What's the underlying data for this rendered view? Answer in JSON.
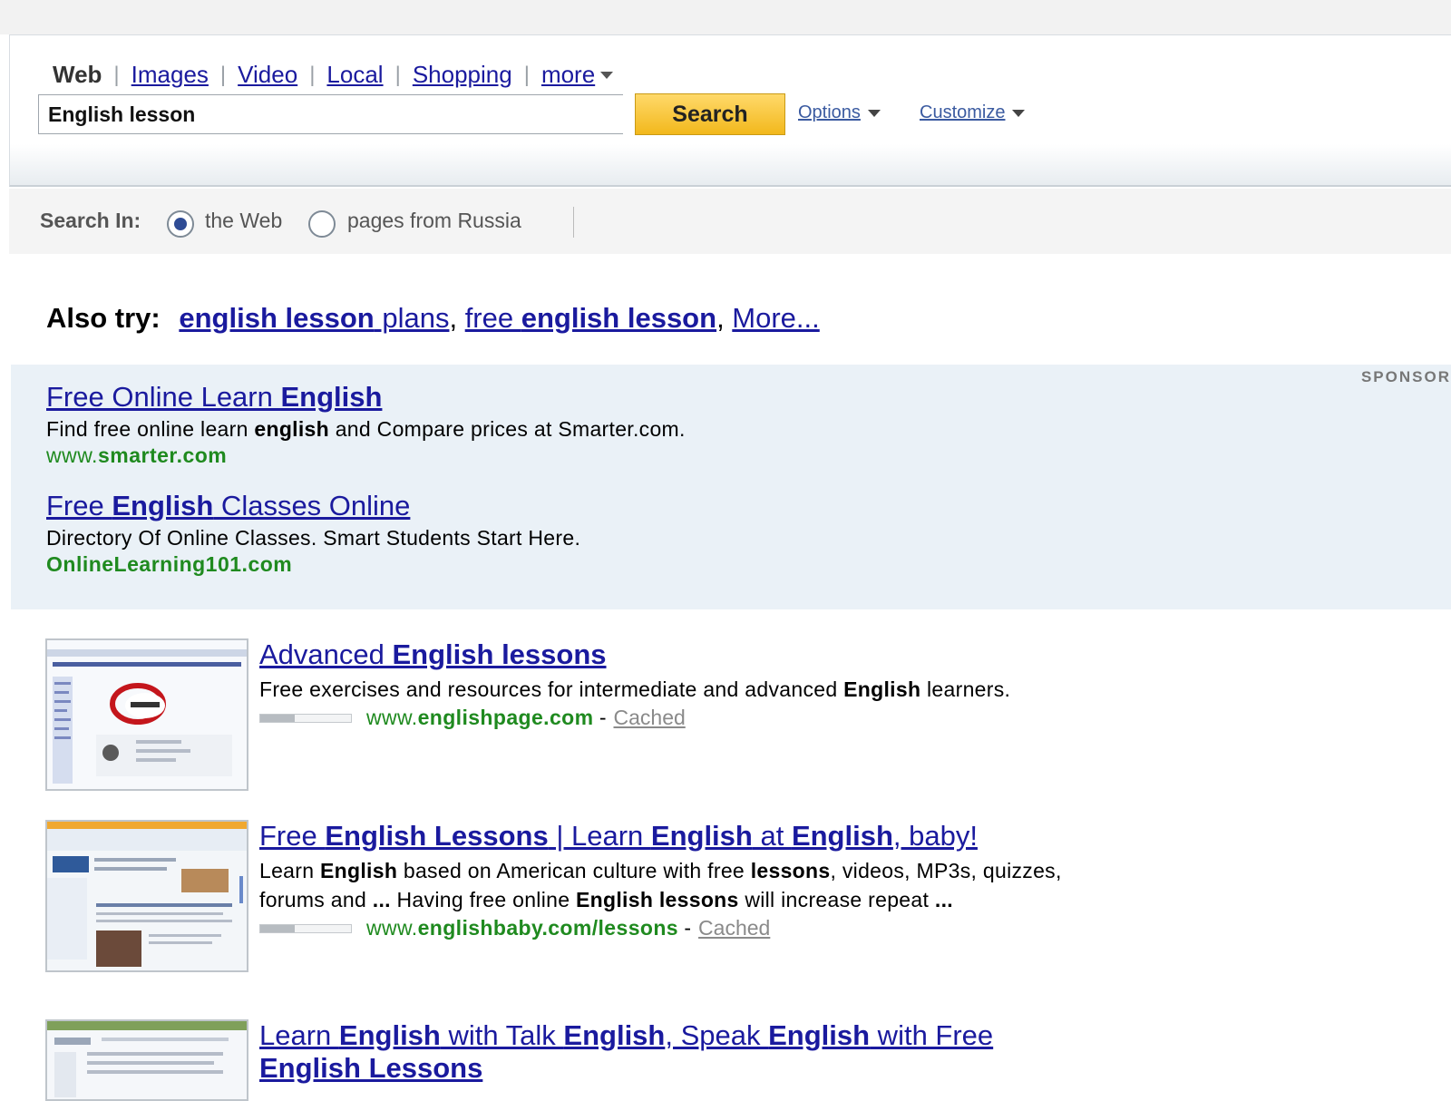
{
  "nav": {
    "tabs": [
      "Web",
      "Images",
      "Video",
      "Local",
      "Shopping"
    ],
    "more_label": "more"
  },
  "search": {
    "query": "English lesson",
    "button_label": "Search",
    "options_label": "Options",
    "customize_label": "Customize"
  },
  "search_in": {
    "label": "Search In:",
    "options": [
      "the Web",
      "pages from Russia"
    ],
    "selected": "the Web"
  },
  "also_try": {
    "label": "Also try:",
    "suggestions": [
      {
        "bold": "english lesson",
        "rest": " plans"
      },
      {
        "pre": "free ",
        "bold": "english lesson"
      }
    ],
    "more_label": "More..."
  },
  "sponsored": {
    "label": "SPONSOR",
    "ads": [
      {
        "title_pre": "Free Online Learn ",
        "title_bold": "English",
        "title_post": "",
        "desc_pre": "Find free online learn ",
        "desc_bold": "english",
        "desc_post": " and Compare prices at Smarter.com.",
        "url_pre": "www.",
        "url_bold": "smarter.com"
      },
      {
        "title_pre": "Free ",
        "title_bold": "English",
        "title_post": " Classes Online",
        "desc_pre": "Directory Of Online Classes. Smart Students Start Here.",
        "desc_bold": "",
        "desc_post": "",
        "url_pre": "",
        "url_bold": "OnlineLearning101.com"
      }
    ]
  },
  "results": [
    {
      "title": [
        {
          "t": "Advanced ",
          "b": false
        },
        {
          "t": "English lessons",
          "b": true
        }
      ],
      "desc": [
        {
          "t": "Free exercises and resources for intermediate and advanced ",
          "b": false
        },
        {
          "t": "English",
          "b": true
        },
        {
          "t": " learners.",
          "b": false
        }
      ],
      "url_pre": "www.",
      "url_bold": "englishpage.com",
      "cached_label": "Cached"
    },
    {
      "title": [
        {
          "t": "Free ",
          "b": false
        },
        {
          "t": "English Lessons",
          "b": true
        },
        {
          "t": " | Learn ",
          "b": false
        },
        {
          "t": "English",
          "b": true
        },
        {
          "t": " at ",
          "b": false
        },
        {
          "t": "English",
          "b": true
        },
        {
          "t": ", baby!",
          "b": false
        }
      ],
      "desc": [
        {
          "t": "Learn ",
          "b": false
        },
        {
          "t": "English",
          "b": true
        },
        {
          "t": " based on American culture with free ",
          "b": false
        },
        {
          "t": "lessons",
          "b": true
        },
        {
          "t": ", videos, MP3s, quizzes, forums and ",
          "b": false
        },
        {
          "t": "...",
          "b": true
        },
        {
          "t": " Having free online ",
          "b": false
        },
        {
          "t": "English lessons",
          "b": true
        },
        {
          "t": " will increase repeat ",
          "b": false
        },
        {
          "t": "...",
          "b": true
        }
      ],
      "url_pre": "www.",
      "url_bold": "englishbaby.com/lessons",
      "cached_label": "Cached"
    },
    {
      "title": [
        {
          "t": "Learn ",
          "b": false
        },
        {
          "t": "English",
          "b": true
        },
        {
          "t": " with Talk ",
          "b": false
        },
        {
          "t": "English",
          "b": true
        },
        {
          "t": ", Speak ",
          "b": false
        },
        {
          "t": "English",
          "b": true
        },
        {
          "t": " with Free ",
          "b": false
        },
        {
          "t": "English Lessons",
          "b": true
        }
      ],
      "desc": [],
      "url_pre": "",
      "url_bold": "",
      "cached_label": ""
    }
  ],
  "colors": {
    "link": "#1a1a9e",
    "url_green": "#1f8a1f",
    "search_button": "#f2b81c",
    "ads_background": "#eaf1f7"
  }
}
